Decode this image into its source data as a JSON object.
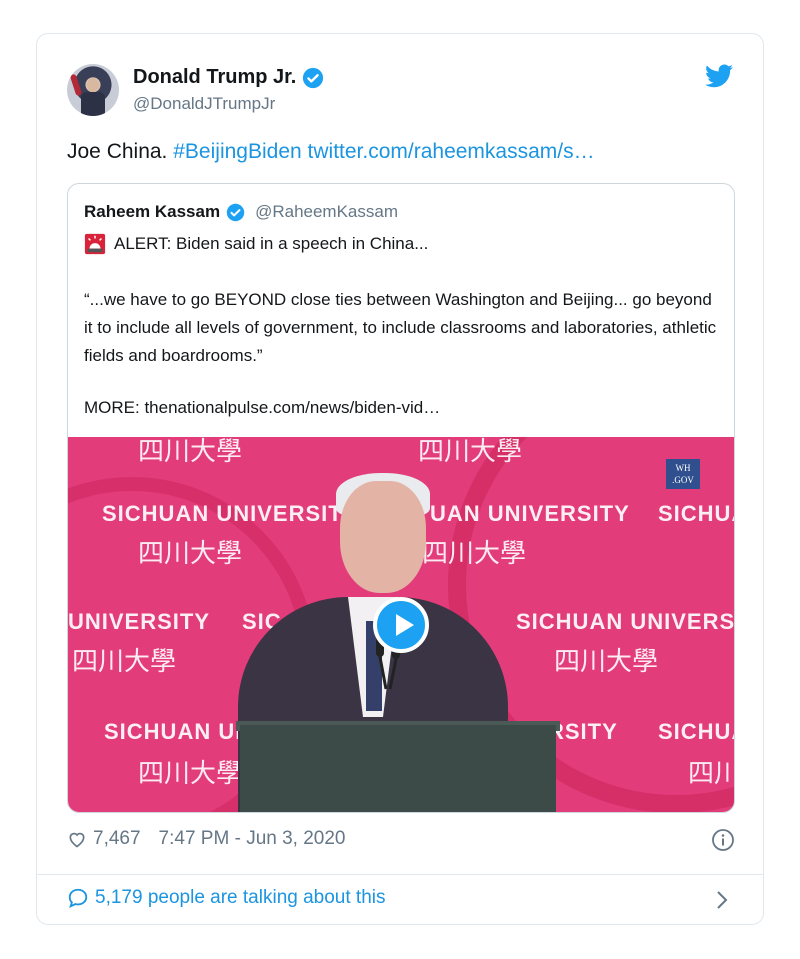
{
  "tweet": {
    "author_name": "Donald Trump Jr.",
    "author_handle": "@DonaldJTrumpJr",
    "text": "Joe China.",
    "hashtag": "#BeijingBiden",
    "link": "twitter.com/raheemkassam/s…",
    "likes": "7,467",
    "timestamp": "7:47 PM - Jun 3, 2020",
    "talking": "5,179 people are talking about this"
  },
  "quote": {
    "author_name": "Raheem Kassam",
    "author_handle": "@RaheemKassam",
    "alert": "ALERT: Biden said in a speech in China...",
    "body": "“...we have to go BEYOND close ties between Washington and Beijing... go beyond it to include all levels of government, to include classrooms and laboratories, athletic fields and boardrooms.”",
    "more": "MORE: thenationalpulse.com/news/biden-vid…"
  },
  "video": {
    "backdrop_lines": [
      "SICHUAN UNIVERSITY",
      "UAN UNIVERSITY",
      "SICHUA",
      "UNIVERSITY",
      "SIC",
      "SICHUAN UNIVERSIT",
      "SICHUAN UN",
      "RSITY",
      "SICHUA"
    ],
    "chinese": "四川大學",
    "badge_line1": "WH",
    "badge_line2": ".GOV"
  },
  "colors": {
    "brand_blue": "#1da1f2",
    "link_blue": "#1b95e0",
    "video_bg": "#e33c7a",
    "muted": "#657786"
  },
  "icons": [
    "verified-icon",
    "twitter-bird-icon",
    "siren-icon",
    "play-icon",
    "heart-icon",
    "info-icon",
    "speech-bubble-icon",
    "chevron-right-icon"
  ]
}
